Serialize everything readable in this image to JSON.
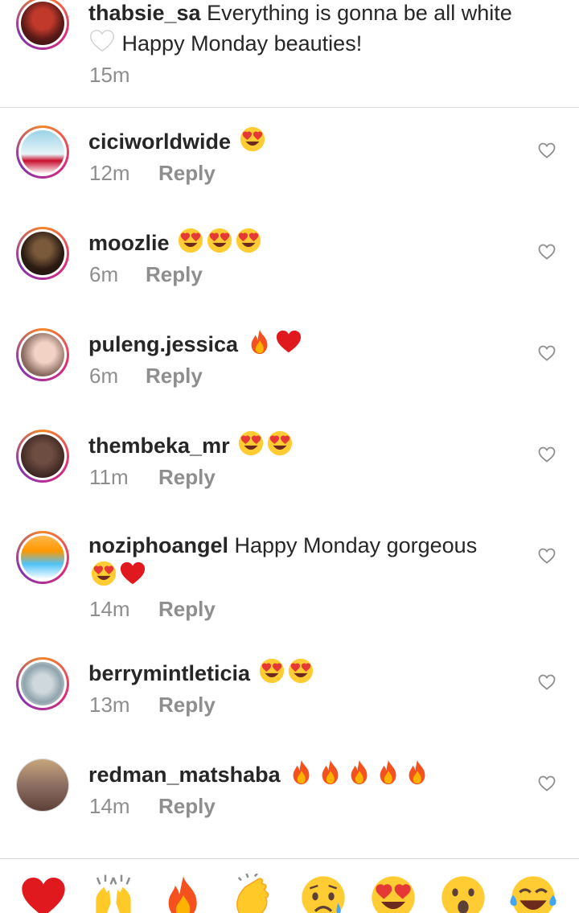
{
  "caption": {
    "username": "thabsie_sa",
    "text_line1": "Everything is gonna be all white",
    "text_line2": "Happy Monday beauties!",
    "time": "15m"
  },
  "comments": [
    {
      "username": "ciciworldwide",
      "text": "",
      "emojis": [
        "heart-eyes"
      ],
      "time": "12m",
      "reply": "Reply"
    },
    {
      "username": "moozlie",
      "text": "",
      "emojis": [
        "heart-eyes",
        "heart-eyes",
        "heart-eyes"
      ],
      "time": "6m",
      "reply": "Reply"
    },
    {
      "username": "puleng.jessica",
      "text": "",
      "emojis": [
        "fire",
        "red-heart"
      ],
      "time": "6m",
      "reply": "Reply"
    },
    {
      "username": "thembeka_mr",
      "text": "",
      "emojis": [
        "heart-eyes",
        "heart-eyes"
      ],
      "time": "11m",
      "reply": "Reply"
    },
    {
      "username": "noziphoangel",
      "text": "Happy Monday gorgeous",
      "emojis": [
        "heart-eyes",
        "red-heart"
      ],
      "time": "14m",
      "reply": "Reply"
    },
    {
      "username": "berrymintleticia",
      "text": "",
      "emojis": [
        "heart-eyes",
        "heart-eyes"
      ],
      "time": "13m",
      "reply": "Reply"
    },
    {
      "username": "redman_matshaba",
      "text": "",
      "emojis": [
        "fire",
        "fire",
        "fire",
        "fire",
        "fire"
      ],
      "time": "14m",
      "reply": "Reply"
    }
  ],
  "reactions": [
    "red-heart",
    "raising-hands",
    "fire",
    "clapping-hands",
    "sad-sweat",
    "heart-eyes",
    "open-mouth",
    "tears-of-joy"
  ],
  "colors": {
    "text": "#262626",
    "muted": "#8e8e8e",
    "divider": "#dbdbdb",
    "ring_start": "#f58529",
    "ring_mid": "#dd2a7b",
    "ring_end": "#8134af"
  }
}
